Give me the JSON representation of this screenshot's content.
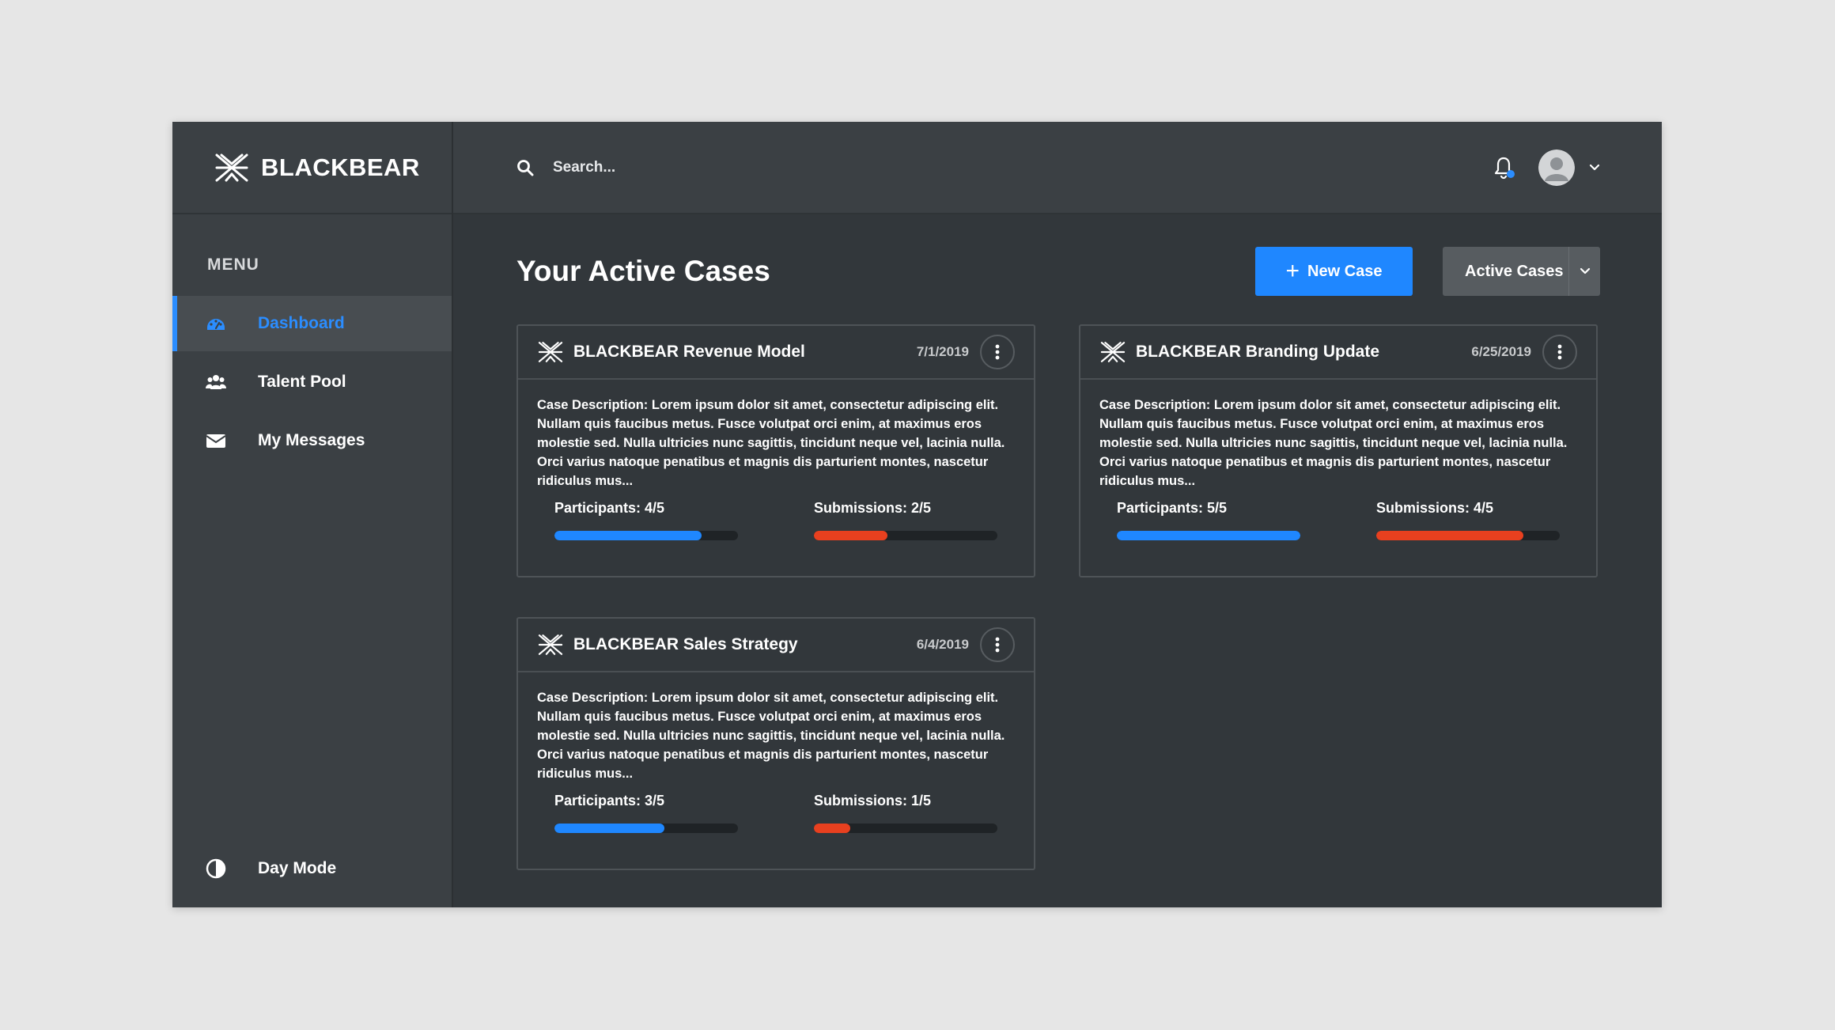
{
  "brand": {
    "name": "BLACKBEAR"
  },
  "sidebar": {
    "menu_title": "MENU",
    "items": [
      {
        "label": "Dashboard",
        "icon": "dashboard-icon",
        "active": true
      },
      {
        "label": "Talent Pool",
        "icon": "users-icon",
        "active": false
      },
      {
        "label": "My Messages",
        "icon": "envelope-icon",
        "active": false
      }
    ],
    "day_mode_label": "Day Mode"
  },
  "topbar": {
    "search_placeholder": "Search..."
  },
  "main": {
    "title": "Your Active Cases",
    "new_case_label": "New Case",
    "filter_selected": "Active Cases"
  },
  "cases": [
    {
      "title": "BLACKBEAR Revenue Model",
      "date": "7/1/2019",
      "description": "Case Description: Lorem ipsum dolor sit amet, consectetur adipiscing elit. Nullam quis faucibus metus. Fusce volutpat orci enim, at maximus eros molestie sed. Nulla ultricies nunc sagittis, tincidunt neque vel, lacinia nulla. Orci varius natoque penatibus et magnis dis parturient montes, nascetur ridiculus mus...",
      "participants_label": "Participants: 4/5",
      "participants_fraction": 0.8,
      "submissions_label": "Submissions: 2/5",
      "submissions_fraction": 0.4
    },
    {
      "title": "BLACKBEAR Branding Update",
      "date": "6/25/2019",
      "description": "Case Description: Lorem ipsum dolor sit amet, consectetur adipiscing elit. Nullam quis faucibus metus. Fusce volutpat orci enim, at maximus eros molestie sed. Nulla ultricies nunc sagittis, tincidunt neque vel, lacinia nulla. Orci varius natoque penatibus et magnis dis parturient montes, nascetur ridiculus mus...",
      "participants_label": "Participants: 5/5",
      "participants_fraction": 1.0,
      "submissions_label": "Submissions: 4/5",
      "submissions_fraction": 0.8
    },
    {
      "title": "BLACKBEAR Sales Strategy",
      "date": "6/4/2019",
      "description": "Case Description: Lorem ipsum dolor sit amet, consectetur adipiscing elit. Nullam quis faucibus metus. Fusce volutpat orci enim, at maximus eros molestie sed. Nulla ultricies nunc sagittis, tincidunt neque vel, lacinia nulla. Orci varius natoque penatibus et magnis dis parturient montes, nascetur ridiculus mus...",
      "participants_label": "Participants: 3/5",
      "participants_fraction": 0.6,
      "submissions_label": "Submissions: 1/5",
      "submissions_fraction": 0.2
    }
  ],
  "colors": {
    "accent": "#1f87ff",
    "submissions": "#e8401f",
    "sidebar_bg": "#3b4044",
    "main_bg": "#32373b"
  }
}
